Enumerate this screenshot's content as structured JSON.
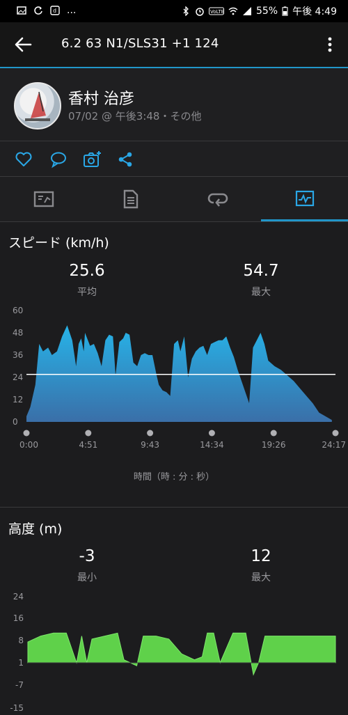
{
  "status": {
    "battery": "55%",
    "time": "午後 4:49",
    "more": "..."
  },
  "toolbar": {
    "title": "6.2  63   N1/SLS31 +1  124"
  },
  "profile": {
    "name": "香村 治彦",
    "meta": "07/02 @ 午後3:48・その他"
  },
  "tabs": [
    "summary-tab",
    "details-tab",
    "laps-tab",
    "charts-tab"
  ],
  "speed": {
    "title": "スピード (km/h)",
    "avg_value": "25.6",
    "avg_label": "平均",
    "max_value": "54.7",
    "max_label": "最大",
    "x_axis_title": "時間（時 : 分 : 秒）",
    "chart_data": {
      "type": "area",
      "title": "スピード (km/h)",
      "xlabel": "時間（時 : 分 : 秒）",
      "ylabel": "",
      "y_ticks": [
        "60",
        "48",
        "36",
        "24",
        "12",
        "0"
      ],
      "x_ticks": [
        "0:00",
        "4:51",
        "9:43",
        "14:34",
        "19:26",
        "24:17"
      ],
      "ylim": [
        0,
        60
      ],
      "average_line": 25.6,
      "x_minutes": [
        0,
        0.3,
        0.7,
        1.0,
        1.3,
        1.7,
        2.0,
        2.4,
        2.8,
        3.2,
        3.6,
        3.9,
        4.1,
        4.3,
        4.5,
        4.6,
        5.0,
        5.3,
        5.6,
        5.9,
        6.2,
        6.5,
        6.8,
        7.0,
        7.3,
        7.6,
        7.8,
        8.1,
        8.4,
        8.7,
        9.0,
        9.3,
        9.6,
        9.9,
        10.2,
        10.4,
        10.7,
        11.0,
        11.3,
        11.6,
        11.9,
        12.1,
        12.4,
        12.7,
        13.0,
        13.3,
        13.6,
        13.9,
        14.2,
        14.5,
        14.8,
        15.1,
        15.4,
        15.7,
        16.0,
        16.3,
        16.6,
        16.9,
        17.2,
        17.5,
        17.8,
        18.1,
        18.4,
        18.7,
        19.0,
        19.5,
        20.0,
        20.5,
        21.0,
        21.5,
        22.0,
        22.5,
        23.0,
        23.5,
        24.0
      ],
      "y_kmh": [
        3,
        8,
        20,
        42,
        38,
        40,
        36,
        38,
        46,
        52,
        44,
        30,
        42,
        45,
        38,
        48,
        41,
        42,
        37,
        30,
        44,
        47,
        46,
        25,
        43,
        45,
        48,
        47,
        32,
        30,
        36,
        37,
        36,
        36,
        26,
        20,
        17,
        16,
        14,
        42,
        44,
        38,
        46,
        24,
        34,
        38,
        40,
        41,
        36,
        42,
        43,
        44,
        44,
        46,
        40,
        35,
        28,
        22,
        16,
        10,
        40,
        44,
        48,
        42,
        33,
        30,
        28,
        25,
        22,
        18,
        14,
        10,
        5,
        3,
        1
      ]
    }
  },
  "altitude": {
    "title": "高度 (m)",
    "min_value": "-3",
    "min_label": "最小",
    "max_value": "12",
    "max_label": "最大",
    "chart_data": {
      "type": "area",
      "title": "高度 (m)",
      "xlabel": "",
      "ylabel": "",
      "y_ticks": [
        "24",
        "16",
        "8",
        "1",
        "-7",
        "-15"
      ],
      "ylim": [
        -15,
        24
      ],
      "x_minutes": [
        0,
        1.0,
        2.0,
        3.0,
        3.8,
        4.2,
        4.6,
        5.0,
        6.0,
        7.0,
        7.5,
        8.0,
        8.5,
        9.0,
        10.0,
        11.0,
        12.0,
        13.0,
        13.6,
        14.0,
        14.5,
        15.0,
        16.0,
        17.0,
        17.6,
        18.0,
        18.5,
        19.0,
        20.0,
        21.0,
        22.0,
        23.0,
        24.0
      ],
      "y_m": [
        8,
        10,
        11,
        11,
        1,
        10,
        1,
        9,
        10,
        11,
        2,
        1,
        0,
        10,
        10,
        9,
        4,
        2,
        3,
        11,
        11,
        1,
        11,
        11,
        -3,
        1,
        10,
        10,
        10,
        10,
        10,
        10,
        10
      ]
    }
  }
}
